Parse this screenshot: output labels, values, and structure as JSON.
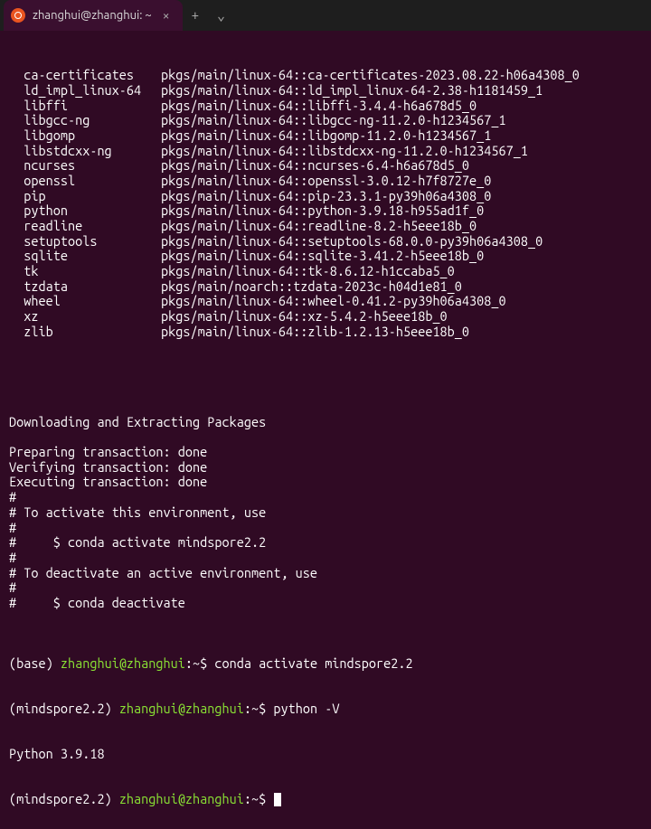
{
  "titlebar": {
    "tab_title": "zhanghui@zhanghui: ~",
    "close_glyph": "×",
    "newtab_glyph": "+",
    "dropdown_glyph": "⌄"
  },
  "packages": [
    {
      "name": "ca-certificates",
      "spec": "pkgs/main/linux-64::ca-certificates-2023.08.22-h06a4308_0"
    },
    {
      "name": "ld_impl_linux-64",
      "spec": "pkgs/main/linux-64::ld_impl_linux-64-2.38-h1181459_1"
    },
    {
      "name": "libffi",
      "spec": "pkgs/main/linux-64::libffi-3.4.4-h6a678d5_0"
    },
    {
      "name": "libgcc-ng",
      "spec": "pkgs/main/linux-64::libgcc-ng-11.2.0-h1234567_1"
    },
    {
      "name": "libgomp",
      "spec": "pkgs/main/linux-64::libgomp-11.2.0-h1234567_1"
    },
    {
      "name": "libstdcxx-ng",
      "spec": "pkgs/main/linux-64::libstdcxx-ng-11.2.0-h1234567_1"
    },
    {
      "name": "ncurses",
      "spec": "pkgs/main/linux-64::ncurses-6.4-h6a678d5_0"
    },
    {
      "name": "openssl",
      "spec": "pkgs/main/linux-64::openssl-3.0.12-h7f8727e_0"
    },
    {
      "name": "pip",
      "spec": "pkgs/main/linux-64::pip-23.3.1-py39h06a4308_0"
    },
    {
      "name": "python",
      "spec": "pkgs/main/linux-64::python-3.9.18-h955ad1f_0"
    },
    {
      "name": "readline",
      "spec": "pkgs/main/linux-64::readline-8.2-h5eee18b_0"
    },
    {
      "name": "setuptools",
      "spec": "pkgs/main/linux-64::setuptools-68.0.0-py39h06a4308_0"
    },
    {
      "name": "sqlite",
      "spec": "pkgs/main/linux-64::sqlite-3.41.2-h5eee18b_0"
    },
    {
      "name": "tk",
      "spec": "pkgs/main/linux-64::tk-8.6.12-h1ccaba5_0"
    },
    {
      "name": "tzdata",
      "spec": "pkgs/main/noarch::tzdata-2023c-h04d1e81_0"
    },
    {
      "name": "wheel",
      "spec": "pkgs/main/linux-64::wheel-0.41.2-py39h06a4308_0"
    },
    {
      "name": "xz",
      "spec": "pkgs/main/linux-64::xz-5.4.2-h5eee18b_0"
    },
    {
      "name": "zlib",
      "spec": "pkgs/main/linux-64::zlib-1.2.13-h5eee18b_0"
    }
  ],
  "middle_lines": [
    "",
    "",
    "",
    "Downloading and Extracting Packages",
    "",
    "Preparing transaction: done",
    "Verifying transaction: done",
    "Executing transaction: done",
    "#",
    "# To activate this environment, use",
    "#",
    "#     $ conda activate mindspore2.2",
    "#",
    "# To deactivate an active environment, use",
    "#",
    "#     $ conda deactivate",
    ""
  ],
  "prompt1": {
    "env": "(base) ",
    "user_host": "zhanghui@zhanghui",
    "path": ":",
    "tilde": "~",
    "dollar": "$ ",
    "cmd": "conda activate mindspore2.2"
  },
  "prompt2": {
    "env": "(mindspore2.2) ",
    "user_host": "zhanghui@zhanghui",
    "path": ":",
    "tilde": "~",
    "dollar": "$ ",
    "cmd": "python -V"
  },
  "python_version_line": "Python 3.9.18",
  "prompt3": {
    "env": "(mindspore2.2) ",
    "user_host": "zhanghui@zhanghui",
    "path": ":",
    "tilde": "~",
    "dollar": "$ ",
    "cmd": ""
  }
}
